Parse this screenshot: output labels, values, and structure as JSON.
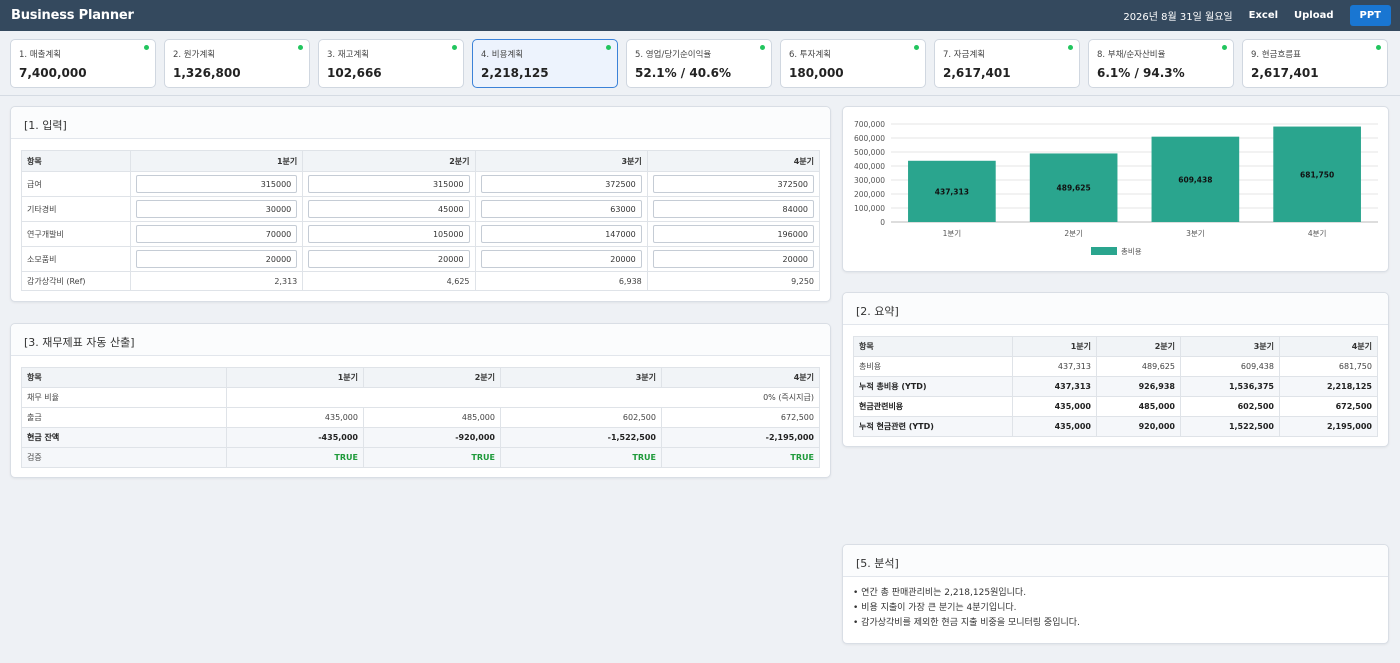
{
  "app": {
    "title": "Business Planner",
    "date": "2026년 8월 31일 월요일",
    "excel_label": "Excel",
    "upload_label": "Upload",
    "ppt_label": "PPT"
  },
  "cards": [
    {
      "label": "1. 매출계획",
      "value": "7,400,000",
      "active": false
    },
    {
      "label": "2. 원가계획",
      "value": "1,326,800",
      "active": false
    },
    {
      "label": "3. 재고계획",
      "value": "102,666",
      "active": false
    },
    {
      "label": "4. 비용계획",
      "value": "2,218,125",
      "active": true
    },
    {
      "label": "5. 영업/당기순이익율",
      "value": "52.1% / 40.6%",
      "active": false
    },
    {
      "label": "6. 투자계획",
      "value": "180,000",
      "active": false
    },
    {
      "label": "7. 자금계획",
      "value": "2,617,401",
      "active": false
    },
    {
      "label": "8. 부채/순자산비율",
      "value": "6.1% / 94.3%",
      "active": false
    },
    {
      "label": "9. 현금흐름표",
      "value": "2,617,401",
      "active": false
    }
  ],
  "status_color": "#22c55e",
  "input_panel": {
    "title": "[1. 입력]",
    "headers": [
      "항목",
      "1분기",
      "2분기",
      "3분기",
      "4분기"
    ],
    "rows": [
      {
        "label": "급여",
        "values": [
          "315000",
          "315000",
          "372500",
          "372500"
        ]
      },
      {
        "label": "기타경비",
        "values": [
          "30000",
          "45000",
          "63000",
          "84000"
        ]
      },
      {
        "label": "연구개발비",
        "values": [
          "70000",
          "105000",
          "147000",
          "196000"
        ]
      },
      {
        "label": "소모품비",
        "values": [
          "20000",
          "20000",
          "20000",
          "20000"
        ]
      }
    ],
    "ref_row": {
      "label": "감가상각비 (Ref)",
      "values": [
        "2,313",
        "4,625",
        "6,938",
        "9,250"
      ]
    }
  },
  "fin_panel": {
    "title": "[3. 재무제표 자동 산출]",
    "headers": [
      "항목",
      "1분기",
      "2분기",
      "3분기",
      "4분기"
    ],
    "debt_row": {
      "label": "채무 비율",
      "value": "0% (즉시지급)"
    },
    "rows": [
      {
        "label": "출금",
        "values": [
          "435,000",
          "485,000",
          "602,500",
          "672,500"
        ]
      },
      {
        "label": "현금 잔액",
        "values": [
          "-435,000",
          "-920,000",
          "-1,522,500",
          "-2,195,000"
        ]
      },
      {
        "label": "검증",
        "values": [
          "TRUE",
          "TRUE",
          "TRUE",
          "TRUE"
        ]
      }
    ]
  },
  "chart_data": {
    "type": "bar",
    "categories": [
      "1분기",
      "2분기",
      "3분기",
      "4분기"
    ],
    "series": [
      {
        "name": "총비용",
        "values": [
          437313,
          489625,
          609438,
          681750
        ],
        "color": "#2aa58e"
      }
    ],
    "data_labels": [
      "437,313",
      "489,625",
      "609,438",
      "681,750"
    ],
    "yticks": [
      "0",
      "100,000",
      "200,000",
      "300,000",
      "400,000",
      "500,000",
      "600,000",
      "700,000"
    ],
    "ylim": [
      0,
      700000
    ],
    "grid": true,
    "legend": "bottom"
  },
  "summary_panel": {
    "title": "[2. 요약]",
    "headers": [
      "항목",
      "1분기",
      "2분기",
      "3분기",
      "4분기"
    ],
    "rows": [
      {
        "label": "총비용",
        "values": [
          "437,313",
          "489,625",
          "609,438",
          "681,750"
        ]
      },
      {
        "label": "누적 총비용 (YTD)",
        "values": [
          "437,313",
          "926,938",
          "1,536,375",
          "2,218,125"
        ]
      },
      {
        "label": "현금관련비용",
        "values": [
          "435,000",
          "485,000",
          "602,500",
          "672,500"
        ]
      },
      {
        "label": "누적 현금관련 (YTD)",
        "values": [
          "435,000",
          "920,000",
          "1,522,500",
          "2,195,000"
        ]
      }
    ]
  },
  "analysis_panel": {
    "title": "[5. 분석]",
    "lines": [
      "• 연간 총 판매관리비는 2,218,125원입니다.",
      "• 비용 지출이 가장 큰 분기는 4분기입니다.",
      "• 감가상각비를 제외한 현금 지출 비중을 모니터링 중입니다."
    ]
  }
}
